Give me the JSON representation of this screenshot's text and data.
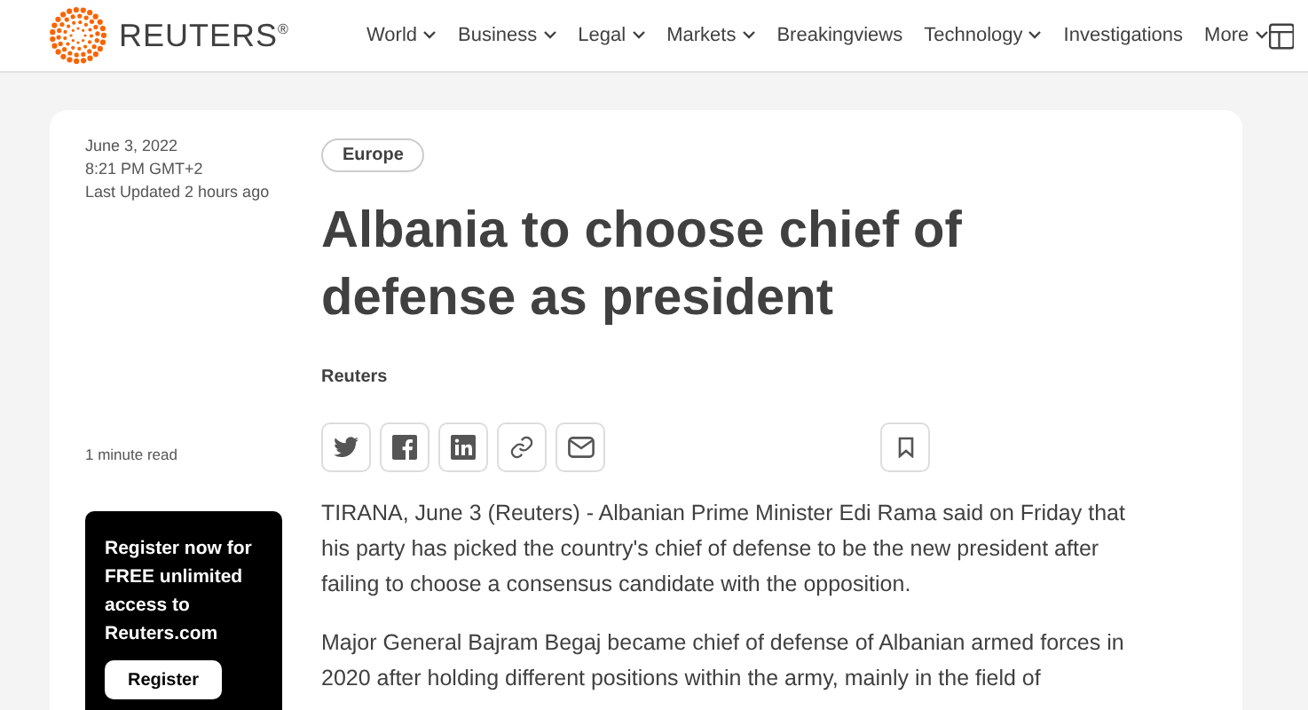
{
  "header": {
    "brand": "REUTERS",
    "brand_mark": "®",
    "nav": [
      {
        "label": "World",
        "dropdown": true
      },
      {
        "label": "Business",
        "dropdown": true
      },
      {
        "label": "Legal",
        "dropdown": true
      },
      {
        "label": "Markets",
        "dropdown": true
      },
      {
        "label": "Breakingviews",
        "dropdown": false
      },
      {
        "label": "Technology",
        "dropdown": true
      },
      {
        "label": "Investigations",
        "dropdown": false
      },
      {
        "label": "More",
        "dropdown": true
      }
    ]
  },
  "sidebar": {
    "date": "June 3, 2022",
    "time": "8:21 PM GMT+2",
    "updated": "Last Updated 2 hours ago",
    "read_time": "1 minute read",
    "promo": {
      "text": "Register now for FREE unlimited access to Reuters.com",
      "button": "Register"
    }
  },
  "article": {
    "tag": "Europe",
    "title": "Albania to choose chief of defense as president",
    "byline": "Reuters",
    "share": [
      {
        "kind": "twitter"
      },
      {
        "kind": "facebook"
      },
      {
        "kind": "linkedin"
      },
      {
        "kind": "link"
      },
      {
        "kind": "email"
      }
    ],
    "paragraphs": [
      "TIRANA, June 3 (Reuters) - Albanian Prime Minister Edi Rama said on Friday that his party has picked the country's chief of defense to be the new president after failing to choose a consensus candidate with the opposition.",
      "Major General Bajram Begaj became chief of defense of Albanian armed forces in 2020 after holding different positions within the army, mainly in the field of"
    ]
  }
}
